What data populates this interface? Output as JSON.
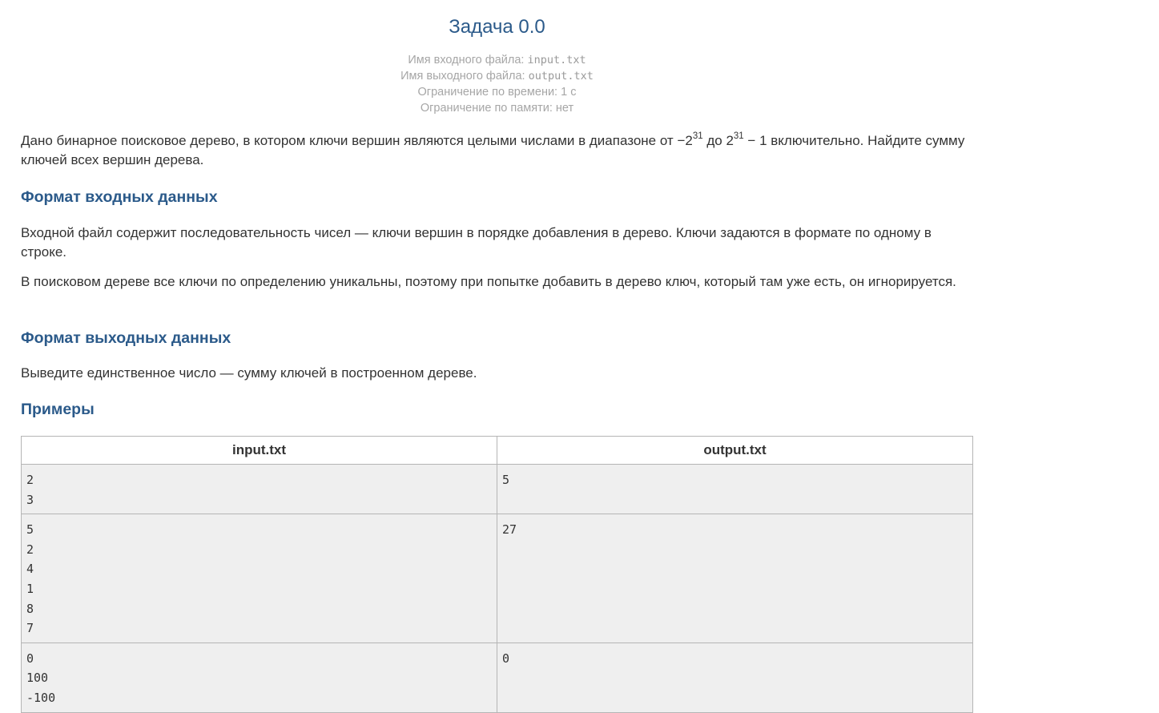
{
  "problem": {
    "title": "Задача 0.0",
    "input_file_label": "Имя входного файла: ",
    "input_file": "input.txt",
    "output_file_label": "Имя выходного файла: ",
    "output_file": "output.txt",
    "time_limit": "Ограничение по времени: 1 с",
    "memory_limit": "Ограничение по памяти: нет"
  },
  "statement": {
    "p1": "Дано бинарное поисковое дерево, в котором ключи вершин являются целыми числами в диапазоне от −2",
    "p1_exp1": "31",
    "p1_mid": " до 2",
    "p1_exp2": "31",
    "p1_end": " − 1 включительно. Найдите сумму ключей всех вершин дерева."
  },
  "input_format": {
    "heading": "Формат входных данных",
    "p1": "Входной файл содержит последовательность чисел — ключи вершин в порядке добавления в дерево. Ключи задаются в формате по одному в строке.",
    "p2": "В поисковом дереве все ключи по определению уникальны, поэтому при попытке добавить в дерево ключ, который там уже есть, он игнорируется."
  },
  "output_format": {
    "heading": "Формат выходных данных",
    "p1": "Выведите единственное число — сумму ключей в построенном дереве."
  },
  "examples": {
    "heading": "Примеры",
    "col_input": "input.txt",
    "col_output": "output.txt",
    "rows": [
      {
        "input": [
          "2",
          "3"
        ],
        "output": [
          "5"
        ]
      },
      {
        "input": [
          "5",
          "2",
          "4",
          "1",
          "8",
          "7"
        ],
        "output": [
          "27"
        ]
      },
      {
        "input": [
          "0",
          "100",
          "-100"
        ],
        "output": [
          "0"
        ]
      }
    ]
  }
}
